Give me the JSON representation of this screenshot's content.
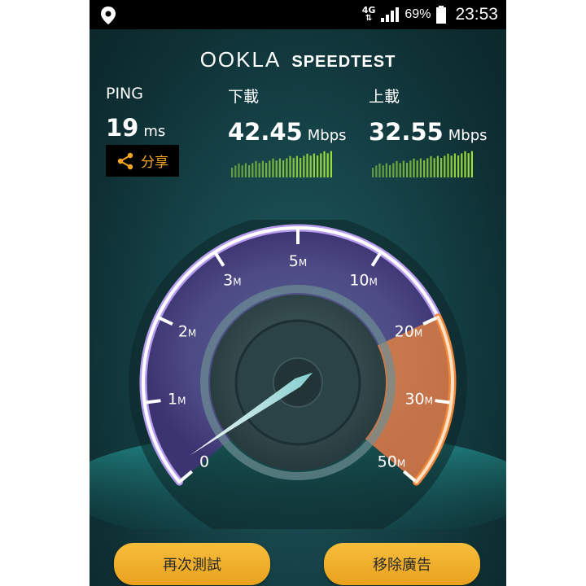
{
  "status_bar": {
    "network_type": "4G",
    "network_arrows": "⇅",
    "battery_percent": "69%",
    "time": "23:53"
  },
  "header": {
    "brand": "OOKLA",
    "product": "SPEEDTEST"
  },
  "ping": {
    "label": "PING",
    "value": "19",
    "unit": "ms"
  },
  "download": {
    "label": "下載",
    "value": "42.45",
    "unit": "Mbps"
  },
  "upload": {
    "label": "上載",
    "value": "32.55",
    "unit": "Mbps"
  },
  "share": {
    "label": "分享"
  },
  "gauge": {
    "scale_labels": [
      {
        "n": "0",
        "u": ""
      },
      {
        "n": "1",
        "u": "M"
      },
      {
        "n": "2",
        "u": "M"
      },
      {
        "n": "3",
        "u": "M"
      },
      {
        "n": "5",
        "u": "M"
      },
      {
        "n": "10",
        "u": "M"
      },
      {
        "n": "20",
        "u": "M"
      },
      {
        "n": "30",
        "u": "M"
      },
      {
        "n": "50",
        "u": "M"
      }
    ],
    "accent_color": "#f0873a",
    "arc_color": "#b79cf0"
  },
  "buttons": {
    "retest": "再次測試",
    "remove_ads": "移除廣告"
  },
  "colors": {
    "button": "#f2b230",
    "share_text": "#f5a623",
    "bars": "#9fe03a"
  }
}
